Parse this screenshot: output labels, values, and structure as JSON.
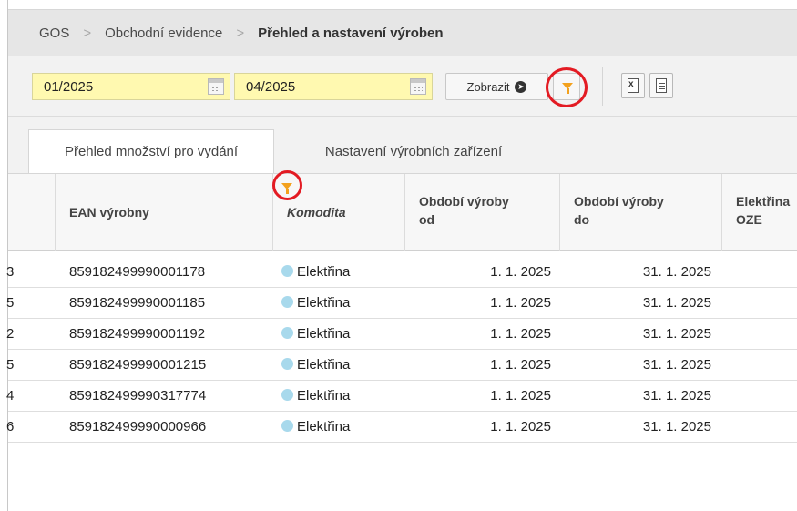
{
  "breadcrumb": {
    "items": [
      "GOS",
      "Obchodní evidence",
      "Přehled a nastavení výroben"
    ],
    "separator": ">"
  },
  "toolbar": {
    "date_from": "01/2025",
    "date_to": "04/2025",
    "show_button": "Zobrazit",
    "show_button_icon": "arrow-right-circle-icon",
    "filter_icon": "funnel-icon",
    "export_excel_icon": "excel-export-icon",
    "export_doc_icon": "document-export-icon",
    "accent_color": "#f3a11d",
    "highlight_color": "#e31b23"
  },
  "tabs": [
    {
      "label": "Přehled množství pro vydání",
      "active": true
    },
    {
      "label": "Nastavení výrobních zařízení",
      "active": false
    }
  ],
  "grid": {
    "columns": [
      {
        "key": "id",
        "label": ""
      },
      {
        "key": "ean",
        "label": "EAN výrobny"
      },
      {
        "key": "commodity",
        "label": "Komodita",
        "filtered": true
      },
      {
        "key": "period_from",
        "label_line1": "Období výroby",
        "label_line2": "od"
      },
      {
        "key": "period_to",
        "label_line1": "Období výroby",
        "label_line2": "do"
      },
      {
        "key": "electricity_oze",
        "label_line1": "Elektřina",
        "label_line2": "OZE"
      }
    ],
    "rows": [
      {
        "id": "3",
        "ean": "859182499990001178",
        "commodity": "Elektřina",
        "period_from": "1. 1. 2025",
        "period_to": "31. 1. 2025"
      },
      {
        "id": "5",
        "ean": "859182499990001185",
        "commodity": "Elektřina",
        "period_from": "1. 1. 2025",
        "period_to": "31. 1. 2025"
      },
      {
        "id": "2",
        "ean": "859182499990001192",
        "commodity": "Elektřina",
        "period_from": "1. 1. 2025",
        "period_to": "31. 1. 2025"
      },
      {
        "id": "5",
        "ean": "859182499990001215",
        "commodity": "Elektřina",
        "period_from": "1. 1. 2025",
        "period_to": "31. 1. 2025"
      },
      {
        "id": "4",
        "ean": "859182499990317774",
        "commodity": "Elektřina",
        "period_from": "1. 1. 2025",
        "period_to": "31. 1. 2025"
      },
      {
        "id": "6",
        "ean": "859182499990000966",
        "commodity": "Elektřina",
        "period_from": "1. 1. 2025",
        "period_to": "31. 1. 2025"
      }
    ],
    "commodity_dot_color": "#a8d9ec"
  }
}
